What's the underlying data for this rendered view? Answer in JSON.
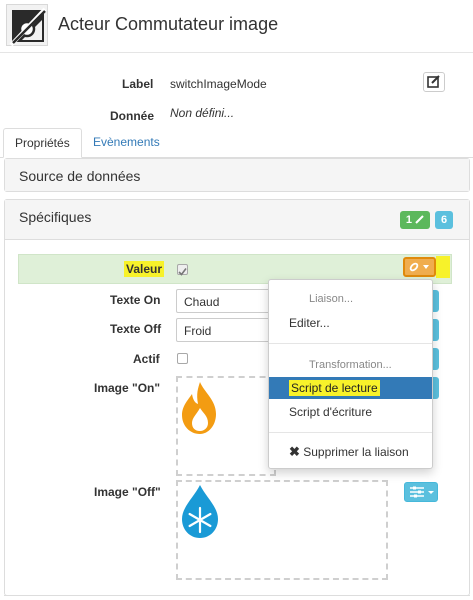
{
  "header": {
    "title": "Acteur Commutateur image",
    "icon": "image-off-icon"
  },
  "meta": {
    "label_label": "Label",
    "label_value": "switchImageMode",
    "donnee_label": "Donnée",
    "donnee_value": "Non défini..."
  },
  "tabs": [
    {
      "label": "Propriétés",
      "active": true
    },
    {
      "label": "Evènements",
      "active": false
    }
  ],
  "panels": {
    "source_title": "Source de données",
    "spec_title": "Spécifiques",
    "spec_badge_count": "1",
    "spec_badge_total": "6"
  },
  "fields": {
    "valeur_label": "Valeur",
    "texte_on_label": "Texte On",
    "texte_on_value": "Chaud",
    "texte_off_label": "Texte Off",
    "texte_off_value": "Froid",
    "actif_label": "Actif",
    "image_on_label": "Image \"On\"",
    "image_off_label": "Image \"Off\""
  },
  "dropdown": {
    "header_liaison": "Liaison...",
    "editer": "Editer...",
    "header_transformation": "Transformation...",
    "script_lecture": "Script de lecture",
    "script_ecriture": "Script d'écriture",
    "supprimer": "Supprimer la liaison"
  },
  "colors": {
    "success": "#5cb85c",
    "info": "#5bc0de",
    "warning": "#f0ad4e",
    "primary": "#337ab7",
    "highlight": "#f7f22a",
    "fire": "#f39c12",
    "water": "#1a9ad6"
  }
}
